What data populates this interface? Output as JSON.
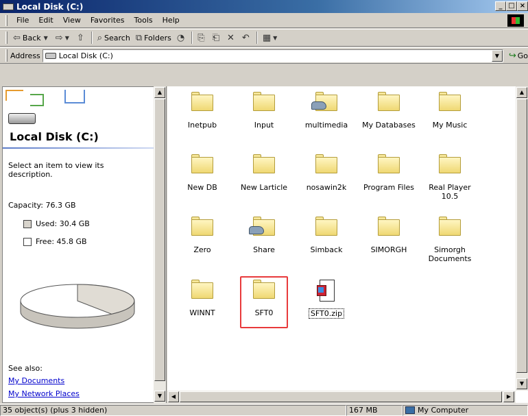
{
  "window": {
    "title": "Local Disk (C:)",
    "buttons": [
      "_",
      "□",
      "×"
    ]
  },
  "menu": [
    "File",
    "Edit",
    "View",
    "Favorites",
    "Tools",
    "Help"
  ],
  "toolbar": {
    "back_label": "Back",
    "search_label": "Search",
    "folders_label": "Folders"
  },
  "address": {
    "label": "Address",
    "value": "Local Disk (C:)",
    "go_label": "Go"
  },
  "left_pane": {
    "title": "Local Disk (C:)",
    "description": "Select an item to view its description.",
    "capacity": "Capacity: 76.3 GB",
    "used": "Used: 30.4 GB",
    "free": "Free: 45.8 GB",
    "used_fraction": 0.398,
    "see_also": "See also:",
    "links": [
      "My Documents",
      "My Network Places"
    ]
  },
  "items": [
    {
      "label": "Inetpub",
      "icon": "folder-icon"
    },
    {
      "label": "Input",
      "icon": "folder-icon"
    },
    {
      "label": "multimedia",
      "icon": "shared-folder-icon"
    },
    {
      "label": "My Databases",
      "icon": "folder-icon"
    },
    {
      "label": "My Music",
      "icon": "folder-icon"
    },
    {
      "label": "New DB",
      "icon": "folder-icon"
    },
    {
      "label": "New Larticle",
      "icon": "folder-icon"
    },
    {
      "label": "nosawin2k",
      "icon": "folder-icon"
    },
    {
      "label": "Program Files",
      "icon": "folder-icon"
    },
    {
      "label": "Real Player 10.5",
      "icon": "folder-icon"
    },
    {
      "label": "Zero",
      "icon": "folder-icon"
    },
    {
      "label": "Share",
      "icon": "shared-folder-icon"
    },
    {
      "label": "Simback",
      "icon": "folder-icon"
    },
    {
      "label": "SIMORGH",
      "icon": "folder-icon"
    },
    {
      "label": "Simorgh Documents",
      "icon": "folder-icon"
    },
    {
      "label": "WINNT",
      "icon": "folder-icon"
    },
    {
      "label": "SFT0",
      "icon": "folder-icon",
      "highlighted": true
    },
    {
      "label": "SFT0.zip",
      "icon": "zip-file-icon"
    }
  ],
  "status": {
    "objects": "35 object(s) (plus 3 hidden)",
    "size": "167 MB",
    "zone": "My Computer"
  },
  "colors": {
    "title_bar": "#0a246a",
    "highlight_box": "#e8393b",
    "link": "#0000cc"
  }
}
